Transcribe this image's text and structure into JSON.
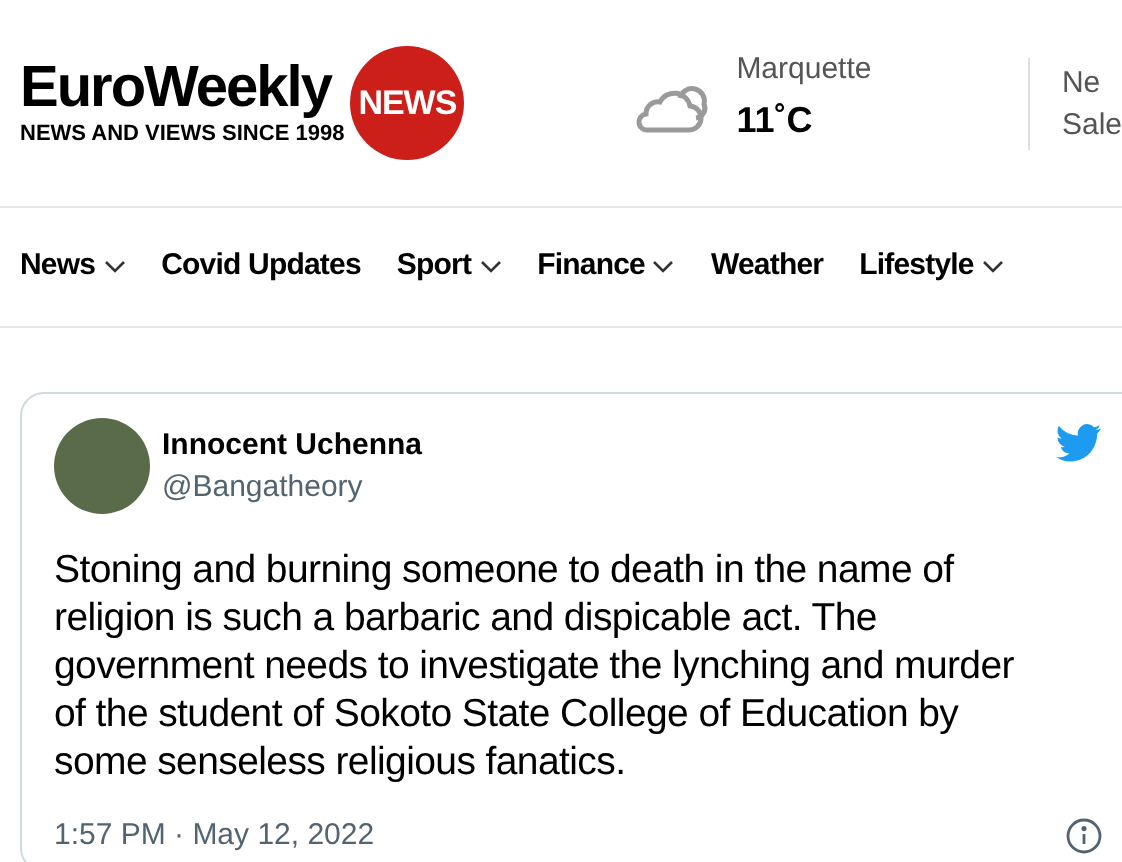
{
  "header": {
    "logo": {
      "name": "EuroWeekly",
      "badge": "NEWS",
      "tagline": "NEWS AND VIEWS SINCE 1998"
    },
    "weather": {
      "city": "Marquette",
      "temperature": "11˚C"
    },
    "edge_item": {
      "line_1": "Ne",
      "line_2": "Sale"
    }
  },
  "nav": [
    {
      "label": "News",
      "dropdown": true
    },
    {
      "label": "Covid Updates",
      "dropdown": false
    },
    {
      "label": "Sport",
      "dropdown": true
    },
    {
      "label": "Finance",
      "dropdown": true
    },
    {
      "label": "Weather",
      "dropdown": false
    },
    {
      "label": "Lifestyle",
      "dropdown": true
    }
  ],
  "tweet": {
    "name": "Innocent Uchenna",
    "handle": "@Bangatheory",
    "text": "Stoning and burning someone to death in the name of religion is such a barbaric and dispicable act. The government needs to investigate the lynching and murder of the student of Sokoto State College of Education by some senseless religious fanatics.",
    "timestamp": "1:57 PM · May 12, 2022"
  }
}
